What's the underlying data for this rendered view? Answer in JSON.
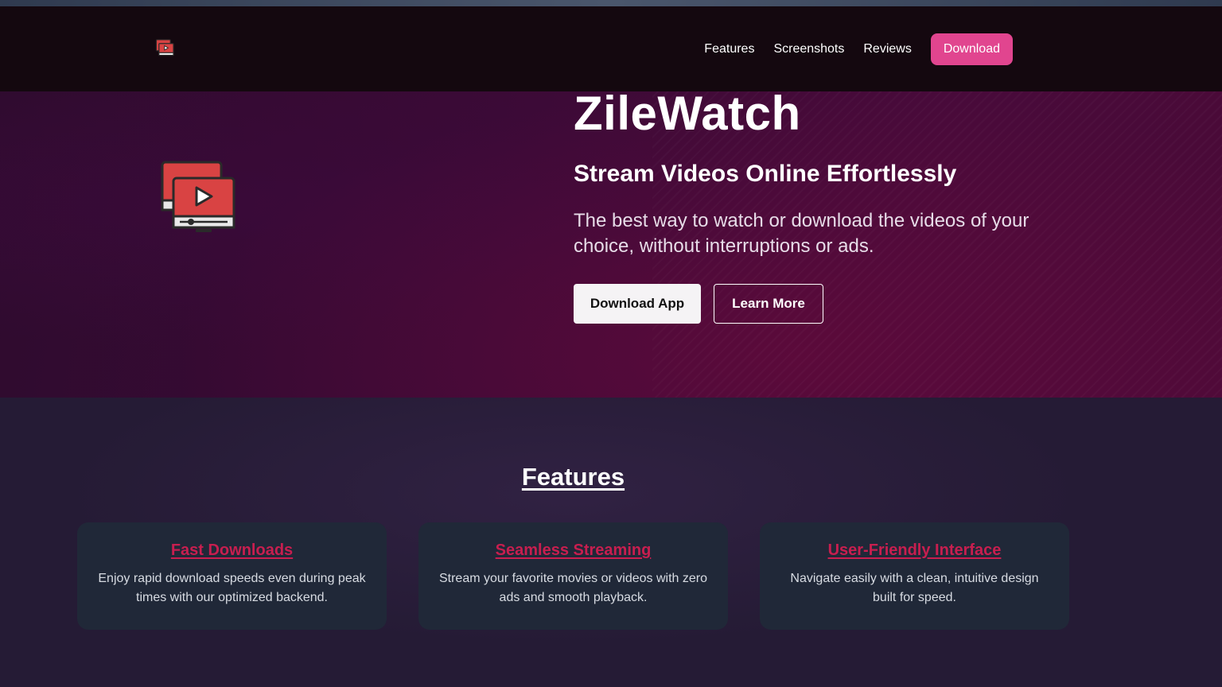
{
  "nav": {
    "logo_icon": "video-player-icon",
    "links": [
      "Features",
      "Screenshots",
      "Reviews"
    ],
    "download_label": "Download",
    "accent_color": "#e1458f"
  },
  "hero": {
    "illustration_icon": "video-player-icon",
    "title": "ZileWatch",
    "subtitle": "Stream Videos Online Effortlessly",
    "description": "The best way to watch or download the videos of your choice, without interruptions or ads.",
    "primary_button": "Download App",
    "secondary_button": "Learn More"
  },
  "features": {
    "title": "Features",
    "title_color": "#c81e4f",
    "cards": [
      {
        "title": "Fast Downloads",
        "description": "Enjoy rapid download speeds even during peak times with our optimized backend."
      },
      {
        "title": "Seamless Streaming",
        "description": "Stream your favorite movies or videos with zero ads and smooth playback."
      },
      {
        "title": "User-Friendly Interface",
        "description": "Navigate easily with a clean, intuitive design built for speed."
      }
    ]
  }
}
